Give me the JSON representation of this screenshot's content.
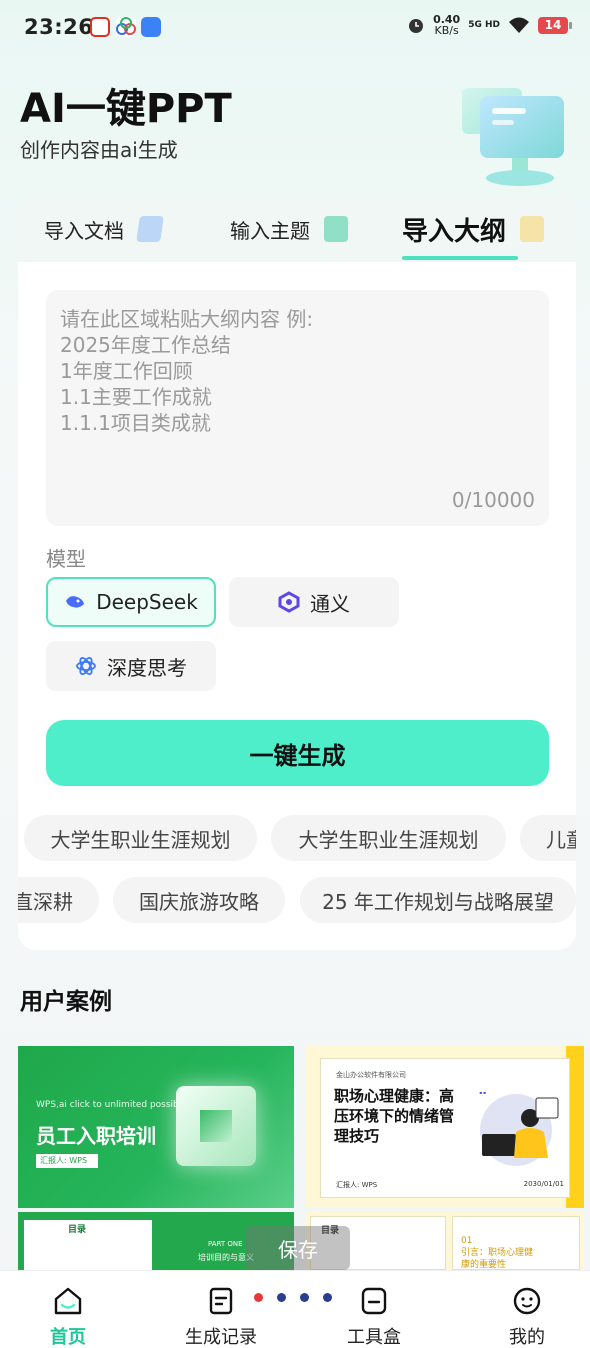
{
  "status_bar": {
    "time": "23:26",
    "net_speed_value": "0.40",
    "net_speed_unit": "KB/s",
    "network": "5G HD",
    "battery": "14"
  },
  "hero": {
    "title": "AI一键PPT",
    "subtitle": "创作内容由ai生成"
  },
  "tabs": [
    {
      "label": "导入文档"
    },
    {
      "label": "输入主题"
    },
    {
      "label": "导入大纲"
    }
  ],
  "outline": {
    "placeholder": "请在此区域粘贴大纲内容 例:\n2025年度工作总结\n1年度工作回顾\n1.1主要工作成就\n1.1.1项目类成就",
    "char_count": "0/10000"
  },
  "model": {
    "label": "模型",
    "options": [
      {
        "label": "DeepSeek"
      },
      {
        "label": "通义"
      },
      {
        "label": "深度思考"
      }
    ]
  },
  "generate_button": "一键生成",
  "suggestions_row1": [
    "大学生职业生涯规划",
    "大学生职业生涯规划",
    "儿童"
  ],
  "suggestions_row2": [
    "直深耕",
    "国庆旅游攻略",
    "25 年工作规划与战略展望"
  ],
  "cases": {
    "title": "用户案例",
    "case1": {
      "small": "WPS,ai click to unlimited possibilities",
      "title": "员工入职培训",
      "tag": "汇报人: WPS"
    },
    "case2": {
      "company": "金山办公软件有限公司",
      "title": "职场心理健康：高压环境下的情绪管理技巧",
      "reporter": "汇报人: WPS",
      "date": "2030/01/01"
    },
    "case3": {
      "toc": "目录",
      "part": "PART ONE",
      "part_title": "培训目的与意义"
    },
    "case4": {
      "toc": "目录",
      "intro": "01\n引言：职场心理健康的重要性"
    },
    "save_label": "保存"
  },
  "bottom_nav": [
    {
      "label": "首页"
    },
    {
      "label": "生成记录"
    },
    {
      "label": "工具盒"
    },
    {
      "label": "我的"
    }
  ],
  "colors": {
    "accent": "#4deec9",
    "accent_dark": "#22c49a"
  }
}
